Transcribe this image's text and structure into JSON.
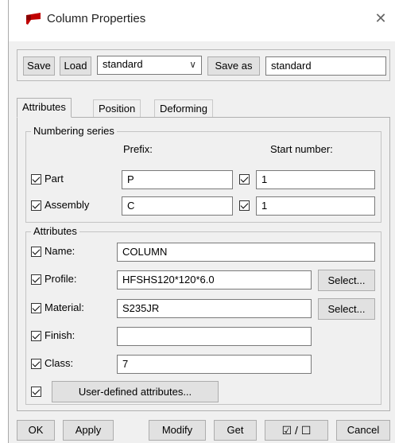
{
  "window": {
    "title": "Column Properties",
    "close_glyph": "✕"
  },
  "toprow": {
    "save_label": "Save",
    "load_label": "Load",
    "preset_value": "standard",
    "save_as_label": "Save as",
    "save_as_value": "standard"
  },
  "tabs": [
    {
      "label": "Attributes",
      "active": true
    },
    {
      "label": "Position",
      "active": false
    },
    {
      "label": "Deforming",
      "active": false
    }
  ],
  "numbering": {
    "title": "Numbering series",
    "prefix_header": "Prefix:",
    "start_header": "Start number:",
    "rows": [
      {
        "label": "Part",
        "checked": true,
        "prefix": "P",
        "start_checked": true,
        "start": "1"
      },
      {
        "label": "Assembly",
        "checked": true,
        "prefix": "C",
        "start_checked": true,
        "start": "1"
      }
    ]
  },
  "attributes": {
    "title": "Attributes",
    "rows": [
      {
        "label": "Name:",
        "checked": true,
        "value": "COLUMN"
      },
      {
        "label": "Profile:",
        "checked": true,
        "value": "HFSHS120*120*6.0",
        "button": "Select..."
      },
      {
        "label": "Material:",
        "checked": true,
        "value": "S235JR",
        "button": "Select..."
      },
      {
        "label": "Finish:",
        "checked": true,
        "value": ""
      },
      {
        "label": "Class:",
        "checked": true,
        "value": "7"
      }
    ],
    "udf_checked": true,
    "udf_label": "User-defined attributes..."
  },
  "bottom": {
    "ok": "OK",
    "apply": "Apply",
    "modify": "Modify",
    "get": "Get",
    "toggle_glyph": "☑ / ☐",
    "cancel": "Cancel"
  },
  "colors": {
    "icon_red": "#c00000",
    "dialog_bg": "#f0f0f0"
  }
}
